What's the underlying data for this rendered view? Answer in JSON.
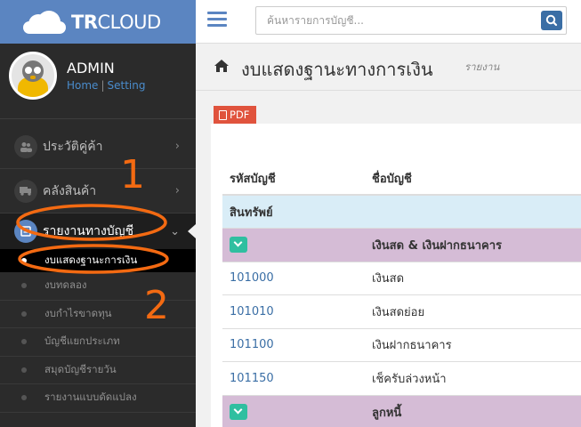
{
  "app": {
    "logo_bold": "TR",
    "logo_light": "CLOUD"
  },
  "profile": {
    "name": "ADMIN",
    "home_link": "Home",
    "separator": "|",
    "setting_link": "Setting"
  },
  "sidebar": {
    "items": [
      {
        "label": "ประวัติคู่ค้า",
        "icon": "users-icon"
      },
      {
        "label": "คลังสินค้า",
        "icon": "truck-icon"
      },
      {
        "label": "รายงานทางบัญชี",
        "icon": "report-icon"
      }
    ],
    "sub_items": [
      {
        "label": "งบแสดงฐานะการเงิน"
      },
      {
        "label": "งบทดลอง"
      },
      {
        "label": "งบกำไรขาดทุน"
      },
      {
        "label": "บัญชีแยกประเภท"
      },
      {
        "label": "สมุดบัญชีรายวัน"
      },
      {
        "label": "รายงานแบบดัดแปลง"
      }
    ]
  },
  "header": {
    "search_placeholder": "ค้นหารายการบัญชี..."
  },
  "page": {
    "title": "งบแสดงฐานะทางการเงิน",
    "subtitle": "รายงาน",
    "pdf_label": "PDF"
  },
  "table": {
    "headers": {
      "code": "รหัสบัญชี",
      "name": "ชื่อบัญชี"
    },
    "category": "สินทรัพย์",
    "group1": "เงินสด & เงินฝากธนาคาร",
    "rows": [
      {
        "code": "101000",
        "name": "เงินสด"
      },
      {
        "code": "101010",
        "name": "เงินสดย่อย"
      },
      {
        "code": "101100",
        "name": "เงินฝากธนาคาร"
      },
      {
        "code": "101150",
        "name": "เช็ครับล่วงหน้า"
      }
    ],
    "group2": "ลูกหนี้"
  },
  "annotations": {
    "marker1": "1",
    "marker2": "2",
    "color": "#f36a12"
  },
  "colors": {
    "brand": "#5b85c1",
    "sidebar": "#2b2b2b",
    "group_row": "#d5bcd6",
    "category_row": "#d9edf7",
    "pdf": "#e0533d",
    "toggle": "#2fbfa0"
  }
}
